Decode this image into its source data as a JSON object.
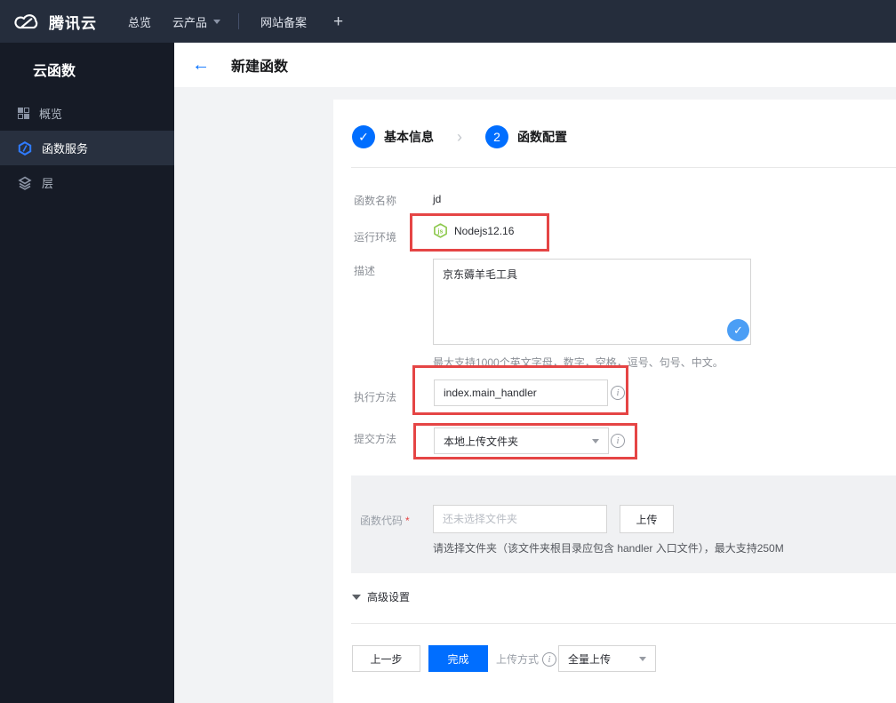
{
  "topbar": {
    "logo_text": "腾讯云",
    "overview": "总览",
    "products": "云产品",
    "beian": "网站备案",
    "plus": "+"
  },
  "sidebar": {
    "title": "云函数",
    "items": [
      {
        "label": "概览",
        "icon": "grid-icon",
        "selected": false
      },
      {
        "label": "函数服务",
        "icon": "function-hexagon-icon",
        "selected": true
      },
      {
        "label": "层",
        "icon": "layers-icon",
        "selected": false
      }
    ]
  },
  "header": {
    "back": "←",
    "title": "新建函数"
  },
  "steps": {
    "step1_label": "基本信息",
    "step1_icon": "✓",
    "separator": "›",
    "step2_number": "2",
    "step2_label": "函数配置"
  },
  "form": {
    "name_label": "函数名称",
    "name_value": "jd",
    "runtime_label": "运行环境",
    "runtime_icon_text": "js",
    "runtime_value": "Nodejs12.16",
    "desc_label": "描述",
    "desc_value": "京东薅羊毛工具",
    "desc_check_icon": "✓",
    "desc_help": "最大支持1000个英文字母，数字，空格，逗号、句号、中文。",
    "handler_label": "执行方法",
    "handler_value": "index.main_handler",
    "handler_info_icon": "i",
    "submit_label": "提交方法",
    "submit_value": "本地上传文件夹",
    "submit_info_icon": "i",
    "code_label": "函数代码",
    "code_required_mark": "*",
    "code_placeholder": "还未选择文件夹",
    "upload_button": "上传",
    "code_help": "请选择文件夹（该文件夹根目录应包含 handler 入口文件），最大支持250M",
    "advanced_toggle": "高级设置"
  },
  "footer": {
    "prev_button": "上一步",
    "finish_button": "完成",
    "upload_mode_label": "上传方式",
    "upload_mode_info_icon": "i",
    "upload_mode_value": "全量上传"
  },
  "colors": {
    "accent_blue": "#006eff",
    "check_blue": "#4b9ef5",
    "annotation_red": "#e54545",
    "node_green": "#8cc84b",
    "topbar_bg": "#252d3c",
    "sidebar_bg": "#161b26"
  }
}
